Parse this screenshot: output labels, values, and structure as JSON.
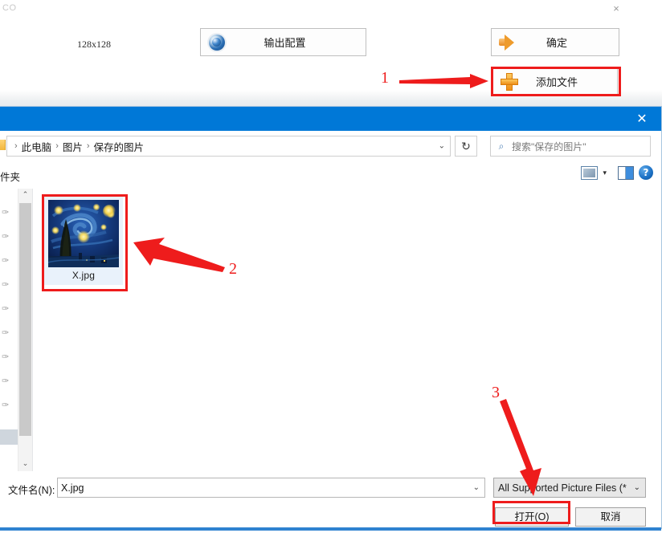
{
  "app": {
    "logo_text": "CO",
    "close_label": "×",
    "size_label": "128x128",
    "buttons": [
      {
        "id": "output-config",
        "label": "输出配置",
        "icon": "gear-icon"
      },
      {
        "id": "confirm",
        "label": "确定",
        "icon": "orange-arrow-icon"
      },
      {
        "id": "add-file",
        "label": "添加文件",
        "icon": "orange-plus-icon"
      }
    ]
  },
  "dialog": {
    "title": "",
    "close_label": "✕",
    "breadcrumb": {
      "separator": "›",
      "items": [
        "此电脑",
        "图片",
        "保存的图片"
      ],
      "caret": "⌄"
    },
    "refresh_icon": "↻",
    "search": {
      "icon": "search-icon",
      "placeholder": "搜索\"保存的图片\""
    },
    "toolbar": {
      "organize_label": "件夹",
      "view_icon": "view-mode-icon",
      "view_caret": "▾",
      "preview_icon": "preview-pane-icon",
      "help_icon": "?"
    },
    "sidebar": {
      "pin_glyph": "📌",
      "pin_count": 9,
      "scroll_up": "⌃",
      "scroll_down": "⌄"
    },
    "files": [
      {
        "name": "X.jpg",
        "thumbnail": "starry-night-painting",
        "selected": true
      }
    ],
    "bottom": {
      "filename_label": "文件名(N):",
      "filename_value": "X.jpg",
      "filename_caret": "⌄",
      "filter_value": "All Supported Picture Files (*",
      "filter_caret": "⌄",
      "open_label": "打开(O)",
      "cancel_label": "取消"
    }
  },
  "annotations": {
    "color": "#ee1c1c",
    "steps": [
      {
        "number": "1",
        "target": "add-file-button"
      },
      {
        "number": "2",
        "target": "file-thumbnail"
      },
      {
        "number": "3",
        "target": "open-button"
      }
    ]
  }
}
